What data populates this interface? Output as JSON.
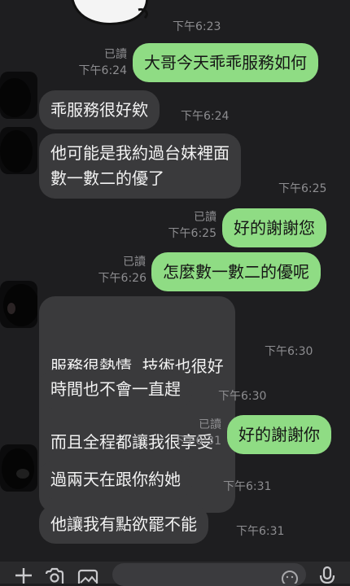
{
  "messages": [
    {
      "text": "下午6:23"
    },
    {
      "read": "已讀",
      "time": "下午6:24",
      "text": "大哥今天乖乖服務如何"
    },
    {
      "text": "乖服務很好欸",
      "time": "下午6:24"
    },
    {
      "lines": [
        "他可能是我約過台妹裡面",
        "數一數二的優了"
      ],
      "time": "下午6:25"
    },
    {
      "read": "已讀",
      "time": "下午6:25",
      "text": "好的謝謝您"
    },
    {
      "read": "已讀",
      "time": "下午6:26",
      "text": "怎麼數一數二的優呢"
    },
    {
      "lines": [
        "服務很熱情  技術也很好",
        "而且全程都讓我很享受"
      ],
      "time": "下午6:30"
    },
    {
      "text": "時間也不會一直趕",
      "time": "下午6:30"
    },
    {
      "read": "已讀",
      "time": "下午6:31",
      "text": "好的謝謝你"
    },
    {
      "text": "過兩天在跟你約她",
      "time": "下午6:31"
    },
    {
      "text": "他讓我有點欲罷不能",
      "time": "下午6:31"
    }
  ],
  "composer": {
    "icons": [
      "plus-icon",
      "camera-icon",
      "image-icon",
      "emoji-icon",
      "microphone-icon"
    ]
  },
  "colors": {
    "background": "#1e1e20",
    "incoming": "#3a3a3c",
    "outgoing": "#8fdc84"
  }
}
